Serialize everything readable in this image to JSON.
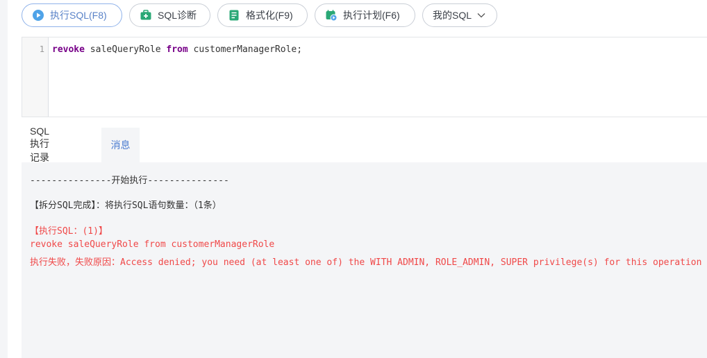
{
  "toolbar": {
    "execute_label": "执行SQL(F8)",
    "diagnose_label": "SQL诊断",
    "format_label": "格式化(F9)",
    "plan_label": "执行计划(F6)",
    "my_sql_label": "我的SQL"
  },
  "editor": {
    "line_number": "1",
    "keyword_revoke": "revoke",
    "text_role": " saleQueryRole ",
    "keyword_from": "from",
    "text_target": " customerManagerRole;"
  },
  "tabs": {
    "history": "SQL执行记录",
    "messages": "消息"
  },
  "messages": {
    "start_line": "---------------开始执行---------------",
    "split_line": "【拆分SQL完成】：将执行SQL语句数量：（1条）",
    "exec_header": "【执行SQL：(1)】",
    "exec_sql": "revoke saleQueryRole from customerManagerRole",
    "fail_line": "执行失败，失败原因：Access denied; you need (at least one of) the WITH ADMIN, ROLE_ADMIN, SUPER privilege(s) for this operation"
  },
  "colors": {
    "accent": "#4a7bd0",
    "error": "#f04848",
    "keyword": "#770088"
  }
}
